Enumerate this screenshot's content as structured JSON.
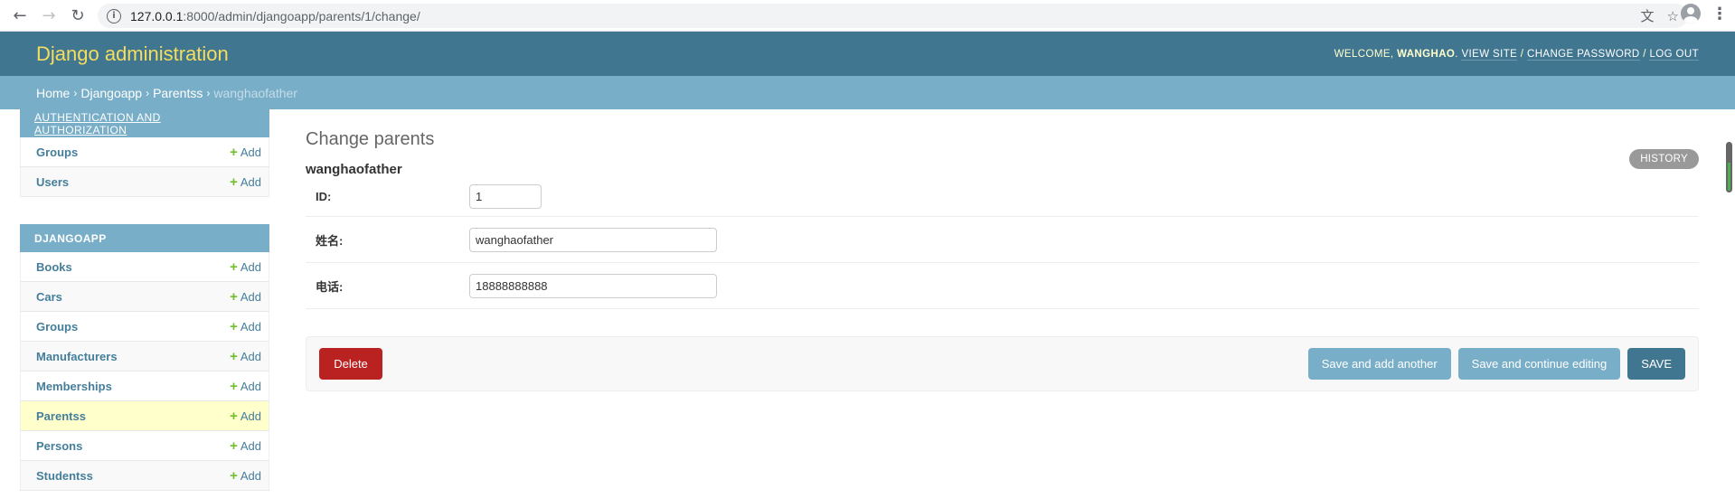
{
  "browser": {
    "url_host": "127.0.0.1",
    "url_path": ":8000/admin/djangoapp/parents/1/change/",
    "icons": [
      "back-arrow-icon",
      "forward-arrow-icon",
      "reload-icon",
      "info-icon",
      "translate-icon",
      "star-icon",
      "profile-icon",
      "menu-icon"
    ]
  },
  "header": {
    "branding": "Django administration",
    "welcome": "WELCOME,",
    "username": "WANGHAO",
    "view_site": "VIEW SITE",
    "change_password": "CHANGE PASSWORD",
    "log_out": "LOG OUT"
  },
  "breadcrumbs": {
    "home": "Home",
    "app": "Djangoapp",
    "model": "Parentss",
    "current": "wanghaofather"
  },
  "sidebar": {
    "add_label": "Add",
    "modules": [
      {
        "caption": "AUTHENTICATION AND AUTHORIZATION",
        "models": [
          "Groups",
          "Users"
        ]
      },
      {
        "caption": "DJANGOAPP",
        "models": [
          "Books",
          "Cars",
          "Groups",
          "Manufacturers",
          "Memberships",
          "Parentss",
          "Persons",
          "Studentss"
        ]
      }
    ],
    "current_model": "Parentss"
  },
  "content": {
    "title": "Change parents",
    "history": "HISTORY",
    "object_name": "wanghaofather",
    "fields": [
      {
        "label": "ID:",
        "value": "1"
      },
      {
        "label": "姓名:",
        "value": "wanghaofather"
      },
      {
        "label": "电话:",
        "value": "18888888888"
      }
    ],
    "buttons": {
      "delete": "Delete",
      "save_add_another": "Save and add another",
      "save_continue": "Save and continue editing",
      "save": "SAVE"
    }
  },
  "colors": {
    "header": "#417690",
    "breadcrumbs": "#79aec8",
    "branding": "#f5dd5d",
    "delete": "#ba2121",
    "add_plus": "#70bf2b",
    "current_row": "#ffffcc"
  }
}
